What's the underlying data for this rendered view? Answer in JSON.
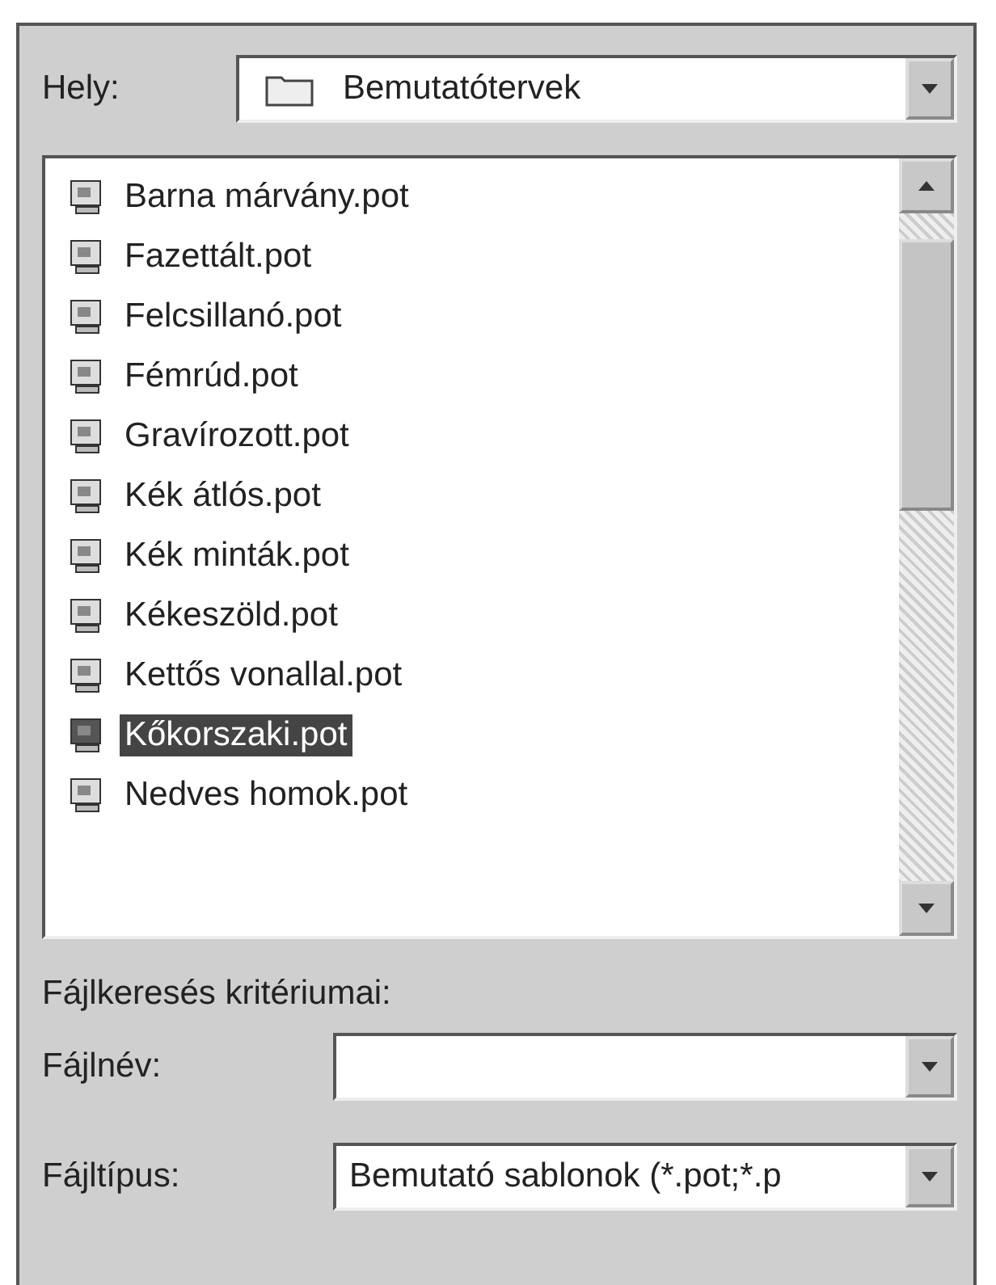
{
  "location": {
    "label": "Hely:",
    "value": "Bemutatótervek"
  },
  "files": [
    {
      "name": "Barna márvány.pot",
      "selected": false
    },
    {
      "name": "Fazettált.pot",
      "selected": false
    },
    {
      "name": "Felcsillanó.pot",
      "selected": false
    },
    {
      "name": "Fémrúd.pot",
      "selected": false
    },
    {
      "name": "Gravírozott.pot",
      "selected": false
    },
    {
      "name": "Kék átlós.pot",
      "selected": false
    },
    {
      "name": "Kék minták.pot",
      "selected": false
    },
    {
      "name": "Kékeszöld.pot",
      "selected": false
    },
    {
      "name": "Kettős vonallal.pot",
      "selected": false
    },
    {
      "name": "Kőkorszaki.pot",
      "selected": true
    },
    {
      "name": "Nedves homok.pot",
      "selected": false
    }
  ],
  "criteria": {
    "heading": "Fájlkeresés kritériumai:",
    "fields": [
      {
        "label": "Fájlnév:"
      },
      {
        "label": "Fájltípus:",
        "value": "Bemutató sablonok (*.pot;*.p"
      }
    ]
  }
}
